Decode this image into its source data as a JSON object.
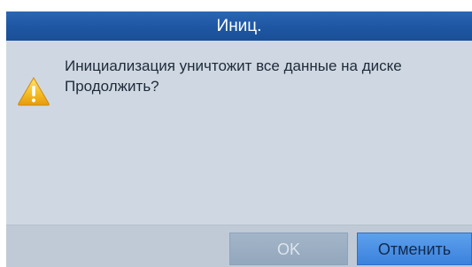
{
  "dialog": {
    "title": "Иниц.",
    "message_line1": "Инициализация уничтожит все данные на диске",
    "message_line2": "Продолжить?",
    "icon": "warning-icon",
    "buttons": {
      "ok_label": "OK",
      "cancel_label": "Отменить"
    }
  },
  "colors": {
    "titlebar": "#1f57a3",
    "body": "#cfd8e2",
    "footer": "#bfcad6",
    "ok_button_disabled": "#9aaec4",
    "cancel_button": "#3b82dd",
    "warning": "#f2b81c"
  }
}
